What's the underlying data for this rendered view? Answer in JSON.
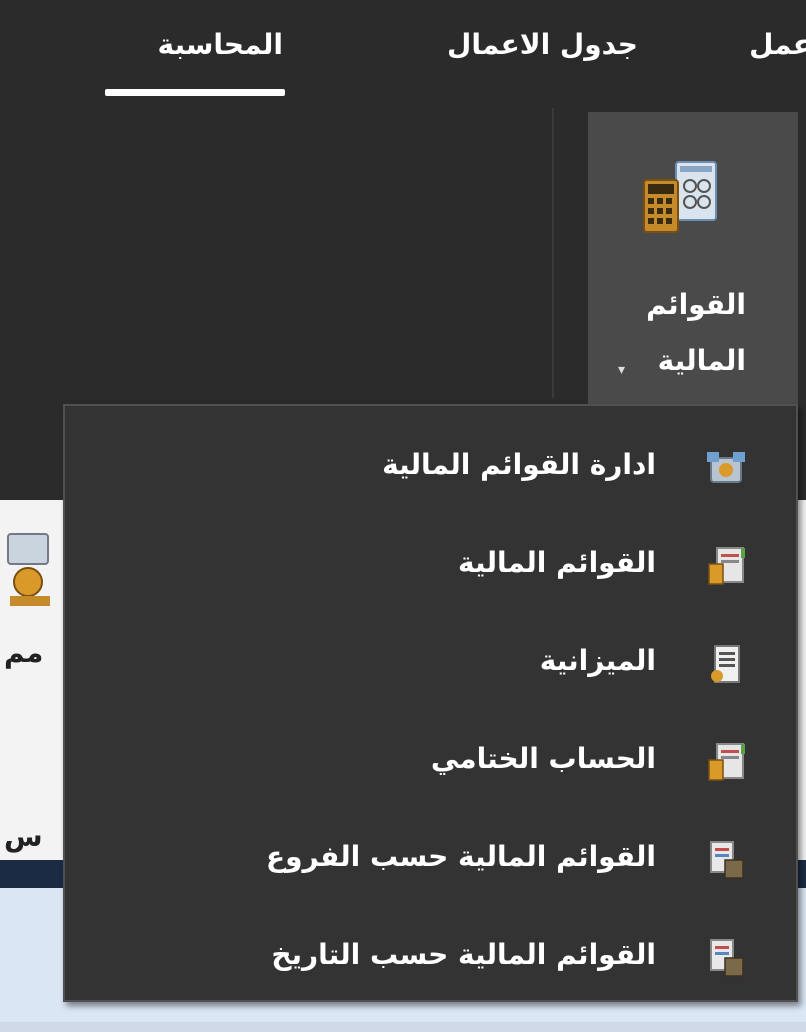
{
  "tabs": {
    "partial": "عمل",
    "schedule": "جدول الاعمال",
    "accounting": "المحاسبة"
  },
  "ribbon": {
    "financial_statements_line1": "القوائم",
    "financial_statements_line2": "المالية",
    "caret": "▾",
    "icon": "calculator-document-icon"
  },
  "menu": {
    "items": [
      {
        "label": "ادارة القوائم المالية",
        "icon": "manage-statements-icon"
      },
      {
        "label": "القوائم المالية",
        "icon": "statement-report-icon"
      },
      {
        "label": "الميزانية",
        "icon": "balance-sheet-icon"
      },
      {
        "label": "الحساب الختامي",
        "icon": "final-account-icon"
      },
      {
        "label": "القوائم المالية حسب الفروع",
        "icon": "branch-report-icon"
      },
      {
        "label": "القوائم المالية حسب التاريخ",
        "icon": "date-report-icon"
      }
    ]
  },
  "background": {
    "left_text_1": "مم",
    "left_text_2": "س"
  },
  "colors": {
    "ribbon_bg": "#2b2b2b",
    "menu_bg": "#333333",
    "highlight_bg": "#4a4a4a",
    "content_bg": "#f3f3f3"
  }
}
